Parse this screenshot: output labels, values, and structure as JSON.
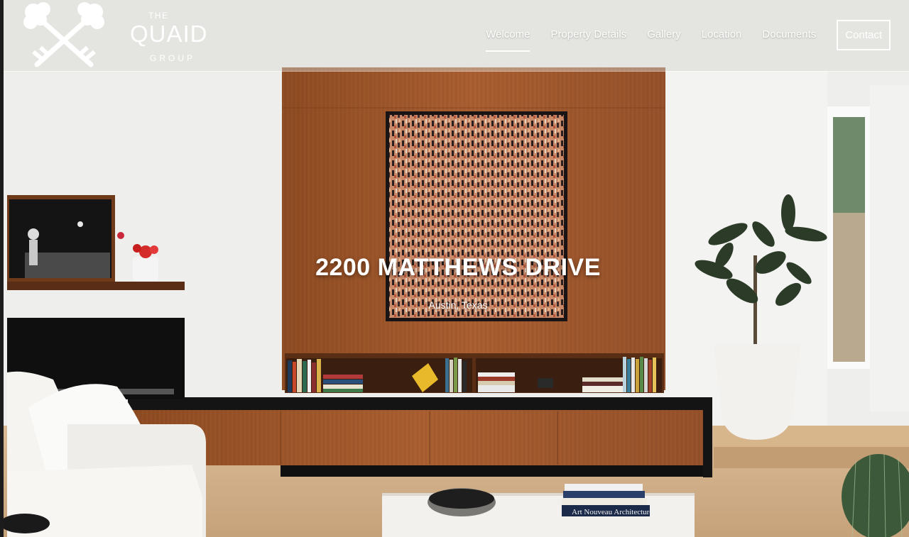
{
  "brand": {
    "the": "THE",
    "name": "QUAID",
    "group": "GROUP"
  },
  "nav": {
    "items": [
      {
        "label": "Welcome",
        "active": true
      },
      {
        "label": "Property Details",
        "active": false
      },
      {
        "label": "Gallery",
        "active": false
      },
      {
        "label": "Location",
        "active": false
      },
      {
        "label": "Documents",
        "active": false
      }
    ],
    "contact": "Contact"
  },
  "hero": {
    "title": "2200 MATTHEWS DRIVE",
    "subtitle": "Austin, Texas",
    "book_spine_text": "Art Nouveau Architecture"
  },
  "colors": {
    "walnut": "#a0582c",
    "wall": "#ececea",
    "floor": "#cfae88",
    "accent_text": "#ffffff"
  }
}
